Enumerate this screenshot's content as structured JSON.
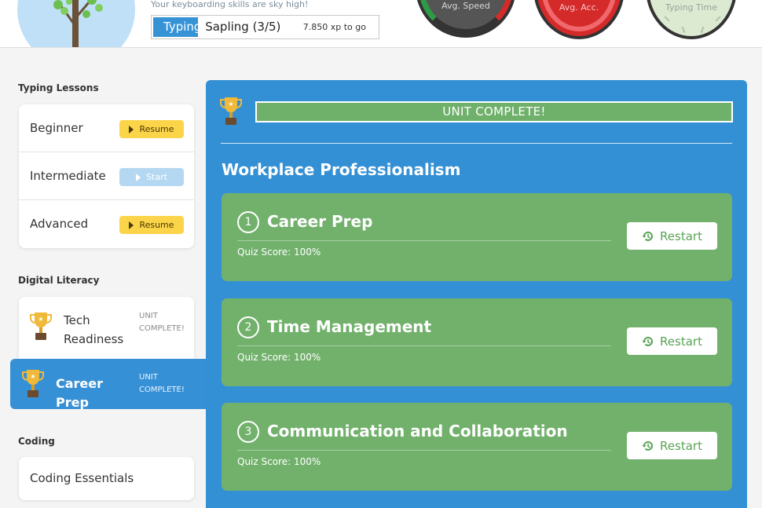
{
  "header": {
    "tagline": "Your keyboarding skills are sky high!",
    "level": {
      "name": "Sapling (3/5)",
      "prefix": "Typing",
      "xp_remaining": "7.850 xp to go",
      "progress": 0.2
    },
    "gauges": [
      {
        "label": "Avg. Speed"
      },
      {
        "label": "Avg. Acc."
      },
      {
        "label": "Typing Time"
      }
    ]
  },
  "sidebar": {
    "typing_lessons": {
      "heading": "Typing Lessons",
      "items": [
        {
          "name": "Beginner",
          "action": "Resume",
          "style": "resume"
        },
        {
          "name": "Intermediate",
          "action": "Start",
          "style": "start"
        },
        {
          "name": "Advanced",
          "action": "Resume",
          "style": "resume"
        }
      ]
    },
    "digital_literacy": {
      "heading": "Digital Literacy",
      "units": [
        {
          "name": "Tech Readiness",
          "status": "UNIT COMPLETE!"
        },
        {
          "name": "Career Prep",
          "status": "UNIT COMPLETE!",
          "active": true
        }
      ]
    },
    "coding": {
      "heading": "Coding",
      "items": [
        {
          "name": "Coding Essentials"
        }
      ]
    }
  },
  "main": {
    "banner": "UNIT COMPLETE!",
    "unit_title": "Workplace Professionalism",
    "lessons": [
      {
        "number": "1",
        "title": "Career Prep",
        "quiz": "Quiz Score: 100%",
        "action": "Restart"
      },
      {
        "number": "2",
        "title": "Time Management",
        "quiz": "Quiz Score: 100%",
        "action": "Restart"
      },
      {
        "number": "3",
        "title": "Communication and Collaboration",
        "quiz": "Quiz Score: 100%",
        "action": "Restart"
      }
    ]
  },
  "colors": {
    "primary_blue": "#3490d4",
    "lesson_green": "#72b16c",
    "resume_yellow": "#fbd44a",
    "start_light_blue": "#b4d8f2"
  },
  "icons": {
    "trophy": "trophy-icon",
    "play": "play-icon",
    "restart": "history-icon"
  }
}
